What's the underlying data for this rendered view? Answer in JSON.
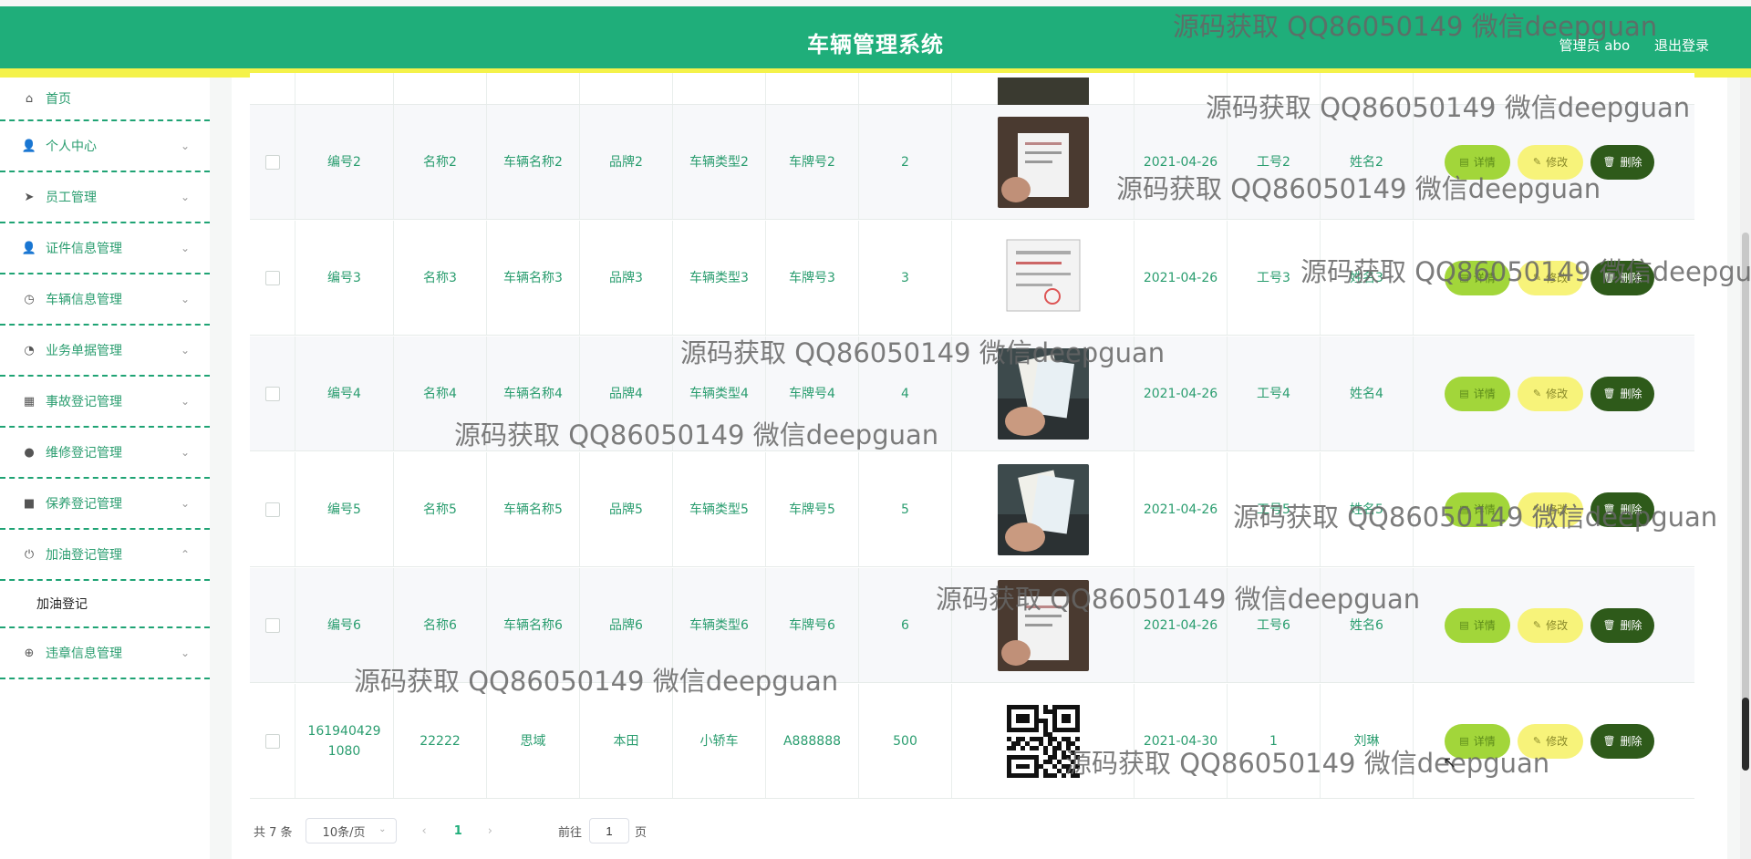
{
  "header": {
    "title": "车辆管理系统",
    "admin": "管理员 abo",
    "logout": "退出登录"
  },
  "sidebar": {
    "items": [
      {
        "label": "首页",
        "icon": "home-icon",
        "glyph": "⌂",
        "chevron": ""
      },
      {
        "label": "个人中心",
        "icon": "user-icon",
        "glyph": "👤",
        "chevron": "⌄"
      },
      {
        "label": "员工管理",
        "icon": "send-icon",
        "glyph": "➤",
        "chevron": "⌄"
      },
      {
        "label": "证件信息管理",
        "icon": "user-icon",
        "glyph": "👤",
        "chevron": "⌄"
      },
      {
        "label": "车辆信息管理",
        "icon": "clock-icon",
        "glyph": "◷",
        "chevron": "⌄"
      },
      {
        "label": "业务单据管理",
        "icon": "compass-icon",
        "glyph": "◔",
        "chevron": "⌄"
      },
      {
        "label": "事故登记管理",
        "icon": "grid-icon",
        "glyph": "▦",
        "chevron": "⌄"
      },
      {
        "label": "维修登记管理",
        "icon": "tool-icon",
        "glyph": "●",
        "chevron": "⌄"
      },
      {
        "label": "保养登记管理",
        "icon": "truck-icon",
        "glyph": "■",
        "chevron": "⌄"
      },
      {
        "label": "加油登记管理",
        "icon": "power-icon",
        "glyph": "⏻",
        "chevron": "⌃"
      },
      {
        "label": "违章信息管理",
        "icon": "target-icon",
        "glyph": "⊕",
        "chevron": "⌄"
      }
    ],
    "submenu": {
      "label": "加油登记"
    }
  },
  "buttons": {
    "detail": "详情",
    "edit": "修改",
    "delete": "删除"
  },
  "rows": [
    {
      "code": "编号2",
      "name": "名称2",
      "vehicle": "车辆名称2",
      "brand": "品牌2",
      "type": "车辆类型2",
      "plate": "车牌号2",
      "qty": "2",
      "date": "2021-04-26",
      "empno": "工号2",
      "empname": "姓名2",
      "image": "receipt-photo"
    },
    {
      "code": "编号3",
      "name": "名称3",
      "vehicle": "车辆名称3",
      "brand": "品牌3",
      "type": "车辆类型3",
      "plate": "车牌号3",
      "qty": "3",
      "date": "2021-04-26",
      "empno": "工号3",
      "empname": "姓名3",
      "image": "invoice-photo"
    },
    {
      "code": "编号4",
      "name": "名称4",
      "vehicle": "车辆名称4",
      "brand": "品牌4",
      "type": "车辆类型4",
      "plate": "车牌号4",
      "qty": "4",
      "date": "2021-04-26",
      "empno": "工号4",
      "empname": "姓名4",
      "image": "ticket-photo"
    },
    {
      "code": "编号5",
      "name": "名称5",
      "vehicle": "车辆名称5",
      "brand": "品牌5",
      "type": "车辆类型5",
      "plate": "车牌号5",
      "qty": "5",
      "date": "2021-04-26",
      "empno": "工号5",
      "empname": "姓名5",
      "image": "ticket-photo"
    },
    {
      "code": "编号6",
      "name": "名称6",
      "vehicle": "车辆名称6",
      "brand": "品牌6",
      "type": "车辆类型6",
      "plate": "车牌号6",
      "qty": "6",
      "date": "2021-04-26",
      "empno": "工号6",
      "empname": "姓名6",
      "image": "receipt-photo"
    },
    {
      "code": "1619404291080",
      "name": "22222",
      "vehicle": "思域",
      "brand": "本田",
      "type": "小轿车",
      "plate": "A888888",
      "qty": "500",
      "date": "2021-04-30",
      "empno": "1",
      "empname": "刘琳",
      "image": "qr-code"
    }
  ],
  "pagination": {
    "total": "共 7 条",
    "page_size": "10条/页",
    "prev": "‹",
    "current": "1",
    "next": "›",
    "goto_label": "前往",
    "goto_value": "1",
    "page_unit": "页"
  },
  "watermark": "源码获取 QQ86050149 微信deepguan",
  "colors": {
    "primary": "#1fae7a",
    "accent_bar": "#f4f24a",
    "detail_btn": "#a2d63a",
    "edit_btn": "#f7f37a",
    "delete_btn": "#2e5a1a"
  }
}
